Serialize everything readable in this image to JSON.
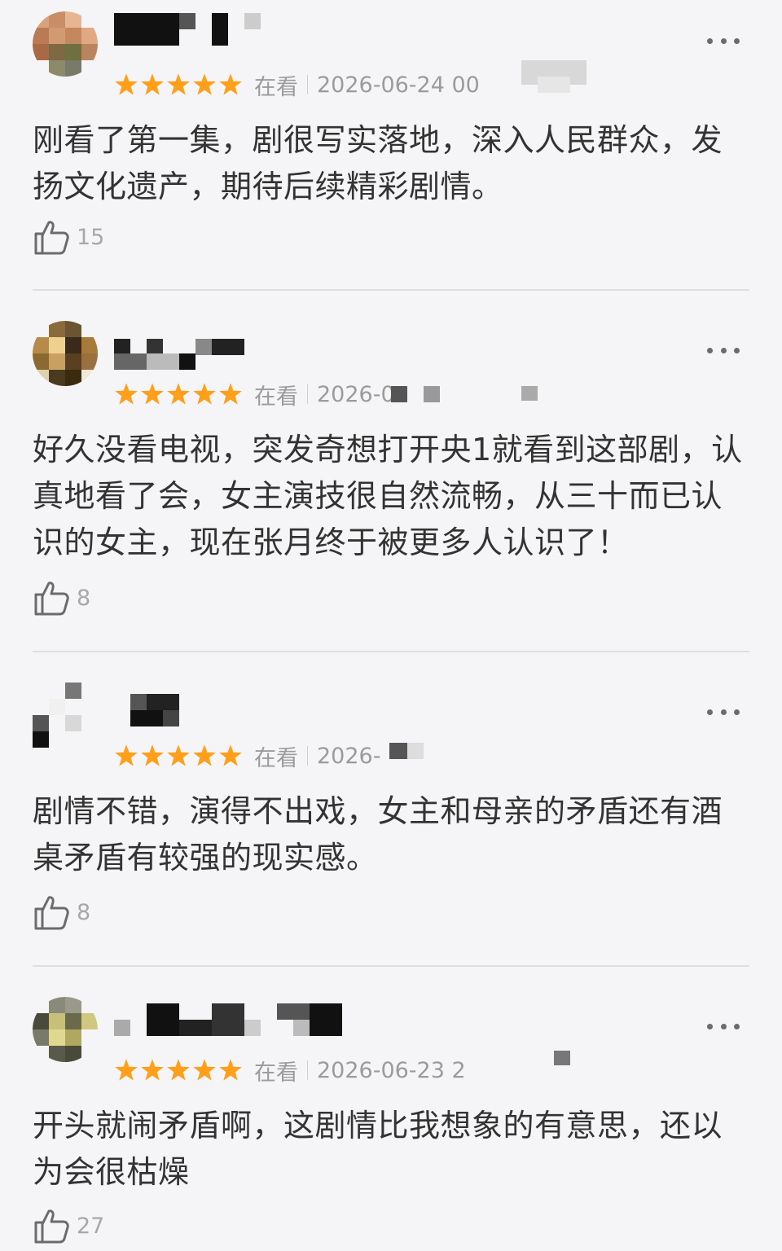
{
  "colors": {
    "star": "#ff9f1a",
    "text": "#333333",
    "meta": "#9b9b9b",
    "divider": "#dedede"
  },
  "reviews": [
    {
      "rating": 5,
      "status": "在看",
      "date": "2026-06-24 00",
      "text": "刚看了第一集，剧很写实落地，深入人民群众，发扬文化遗产，期待后续精彩剧情。",
      "likes": "15"
    },
    {
      "rating": 5,
      "status": "在看",
      "date": "2026-0",
      "text": "好久没看电视，突发奇想打开央1就看到这部剧，认真地看了会，女主演技很自然流畅，从三十而已认识的女主，现在张月终于被更多人认识了！",
      "likes": "8"
    },
    {
      "rating": 5,
      "status": "在看",
      "date": "2026-",
      "text": "剧情不错，演得不出戏，女主和母亲的矛盾还有酒桌矛盾有较强的现实感。",
      "likes": "8"
    },
    {
      "rating": 5,
      "status": "在看",
      "date": "2026-06-23 2",
      "text": "开头就闹矛盾啊，这剧情比我想象的有意思，还以为会很枯燥",
      "likes": "27"
    }
  ],
  "icons": {
    "more": "more-dots-icon",
    "like": "thumbs-up-icon",
    "star": "star-icon"
  }
}
